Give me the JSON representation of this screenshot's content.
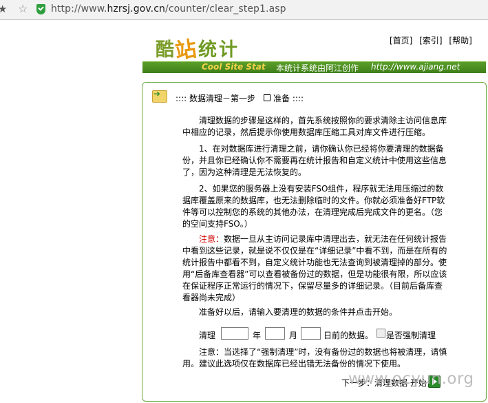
{
  "browser": {
    "url_prefix": "http://www.",
    "url_host": "hzrsj.gov.cn",
    "url_path": "/counter/clear_step1.asp"
  },
  "header": {
    "logo_chars": [
      "酷",
      "站",
      "统",
      "计"
    ],
    "nav": [
      "[首页]",
      "[索引]",
      "[帮助]"
    ],
    "brand": "Cool Site Stat",
    "credit": "本统计系统由阿江创作",
    "site": "http://www.ajiang.net"
  },
  "step": {
    "title_prefix": "::::  数据清理－第一步",
    "title_suffix": "准备  ::::"
  },
  "content": {
    "p1": "清理数据的步骤是这样的，首先系统按照你的要求清除主访问信息库中相应的记录，然后提示你使用数据库压缩工具对库文件进行压缩。",
    "p2": "1、在对数据库进行清理之前，请你确认你已经将你要清理的数据备份，并且你已经确认你不需要再在统计报告和自定义统计中使用这些信息了，因为这种清理是无法恢复的。",
    "p3": "2、如果您的服务器上没有安装FSO组件，程序就无法用压缩过的数据库覆盖原来的数据库，也无法删除临时的文件。你就必须准备好FTP软件等可以控制您的系统的其他办法，在清理完成后完成文件的更名。（您的空间支持FSO。）",
    "p4_warn": "注意：",
    "p4": "数据一旦从主访问记录库中清理出去，就无法在任何统计报告中看到这些记录，就是说不仅仅是在“详细记录”中看不到，而是在所有的统计报告中都看不到，自定义统计功能也无法查询到被清理掉的部分。使用“后备库查看器”可以查看被备份过的数据，但是功能很有限，所以应该在保证程序正常运行的情况下，保留尽量多的详细记录。（目前后备库查看器尚未完成）",
    "p5": "准备好以后，请输入要清理的数据的条件并点击开始。",
    "p6": "注意：当选择了“强制清理”时，没有备份过的数据也将被清理，请慎用。建议此选项仅在数据库已经出错无法备份的情况下使用。"
  },
  "form": {
    "clean_label": "清理",
    "year_label": "年",
    "month_label": "月",
    "day_suffix": "日前的数据。",
    "force_label": "是否强制清理",
    "year_value": "",
    "month_value": "",
    "day_value": ""
  },
  "footer": {
    "next_link": "下一步：清理数据 开始",
    "watermark": "www.ocyun.org"
  }
}
